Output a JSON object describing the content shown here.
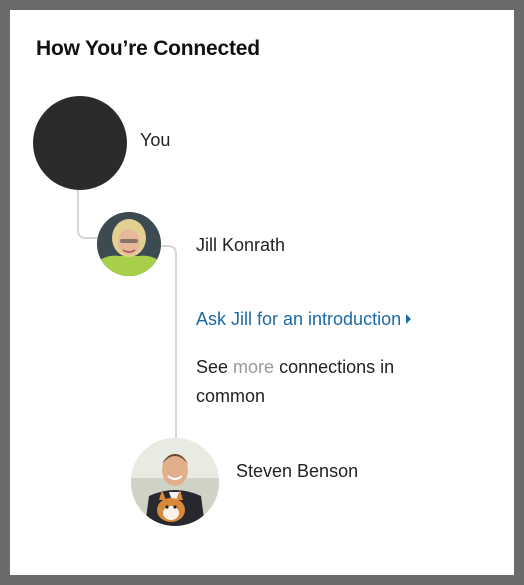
{
  "panel": {
    "title": "How You’re Connected"
  },
  "path": [
    {
      "name": "You"
    },
    {
      "name": "Jill Konrath"
    },
    {
      "name": "Steven Benson"
    }
  ],
  "intro": {
    "link_label": "Ask Jill for an introduction"
  },
  "common": {
    "prefix": "See",
    "link_label": "more",
    "suffix": "connections in common"
  },
  "colors": {
    "link": "#1b6aa6",
    "muted_link": "#999999",
    "connector": "#d6d6d6"
  }
}
